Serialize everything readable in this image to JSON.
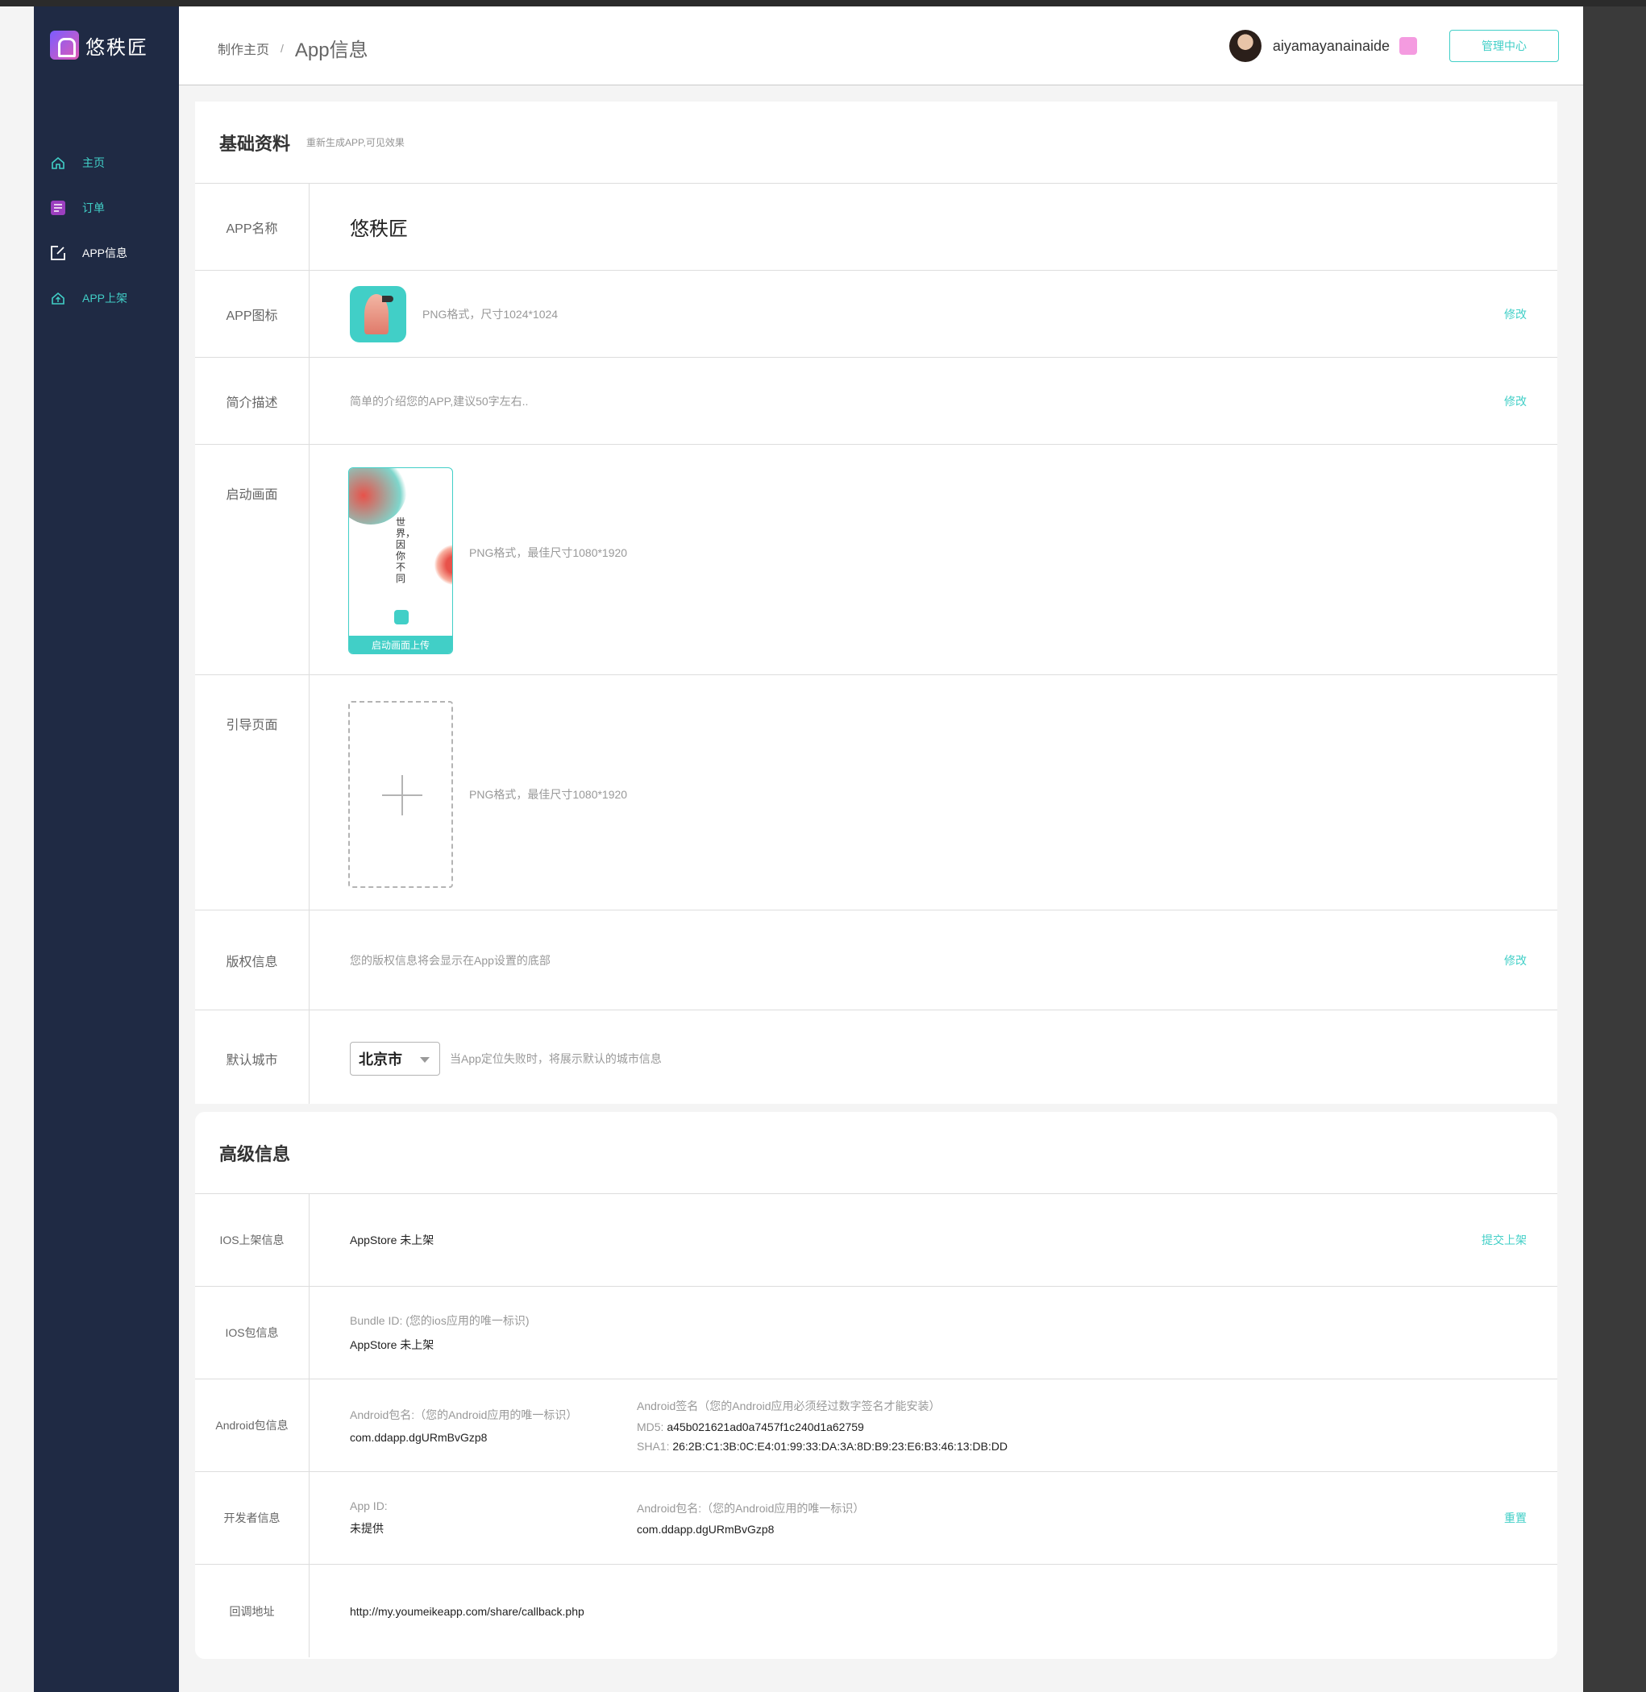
{
  "sidebar": {
    "logo_text": "悠秩匠",
    "items": [
      {
        "label": "主页",
        "icon": "home-icon"
      },
      {
        "label": "订单",
        "icon": "order-icon"
      },
      {
        "label": "APP信息",
        "icon": "edit-icon",
        "active": true
      },
      {
        "label": "APP上架",
        "icon": "upload-icon"
      }
    ]
  },
  "header": {
    "breadcrumb_link": "制作主页",
    "breadcrumb_sep": "/",
    "breadcrumb_current": "App信息",
    "username": "aiyamayanainaide",
    "manage_button": "管理中心"
  },
  "basic": {
    "title": "基础资料",
    "subtitle": "重新生成APP,可见效果",
    "rows": {
      "app_name": {
        "label": "APP名称",
        "value": "悠秩匠"
      },
      "app_icon": {
        "label": "APP图标",
        "hint": "PNG格式，尺寸1024*1024",
        "edit": "修改"
      },
      "desc": {
        "label": "简介描述",
        "placeholder": "简单的介绍您的APP,建议50字左右..",
        "edit": "修改"
      },
      "splash": {
        "label": "启动画面",
        "hint": "PNG格式，最佳尺寸1080*1920",
        "verse": "世界，因你不同",
        "bar_text": "启动画面上传"
      },
      "guide": {
        "label": "引导页面",
        "hint": "PNG格式，最佳尺寸1080*1920"
      },
      "copyright": {
        "label": "版权信息",
        "placeholder": "您的版权信息将会显示在App设置的底部",
        "edit": "修改"
      },
      "city": {
        "label": "默认城市",
        "value": "北京市",
        "hint": "当App定位失败时，将展示默认的城市信息"
      }
    }
  },
  "advanced": {
    "title": "高级信息",
    "rows": {
      "ios_shelf": {
        "label": "IOS上架信息",
        "value": "AppStore  未上架",
        "action": "提交上架"
      },
      "ios_pkg": {
        "label": "IOS包信息",
        "key": "Bundle ID: (您的ios应用的唯一标识)",
        "value": "AppStore  未上架"
      },
      "android_pkg": {
        "label": "Android包信息",
        "pkg_key": "Android包名:（您的Android应用的唯一标识）",
        "pkg_value": "com.ddapp.dgURmBvGzp8",
        "sign_key": "Android签名（您的Android应用必须经过数字签名才能安装）",
        "md5_key": "MD5:",
        "md5_value": "a45b021621ad0a7457f1c240d1a62759",
        "sha1_key": "SHA1:",
        "sha1_value": "26:2B:C1:3B:0C:E4:01:99:33:DA:3A:8D:B9:23:E6:B3:46:13:DB:DD"
      },
      "developer": {
        "label": "开发者信息",
        "appid_key": "App ID:",
        "appid_value": "未提供",
        "pkg_key": "Android包名:（您的Android应用的唯一标识）",
        "pkg_value": "com.ddapp.dgURmBvGzp8",
        "action": "重置"
      },
      "callback": {
        "label": "回调地址",
        "value": "http://my.youmeikeapp.com/share/callback.php"
      }
    }
  },
  "colors": {
    "accent": "#41cfc7",
    "sidebar_bg": "#1f2a44",
    "page_bg": "#f4f4f4",
    "line": "#dddddd",
    "title": "#333333"
  }
}
